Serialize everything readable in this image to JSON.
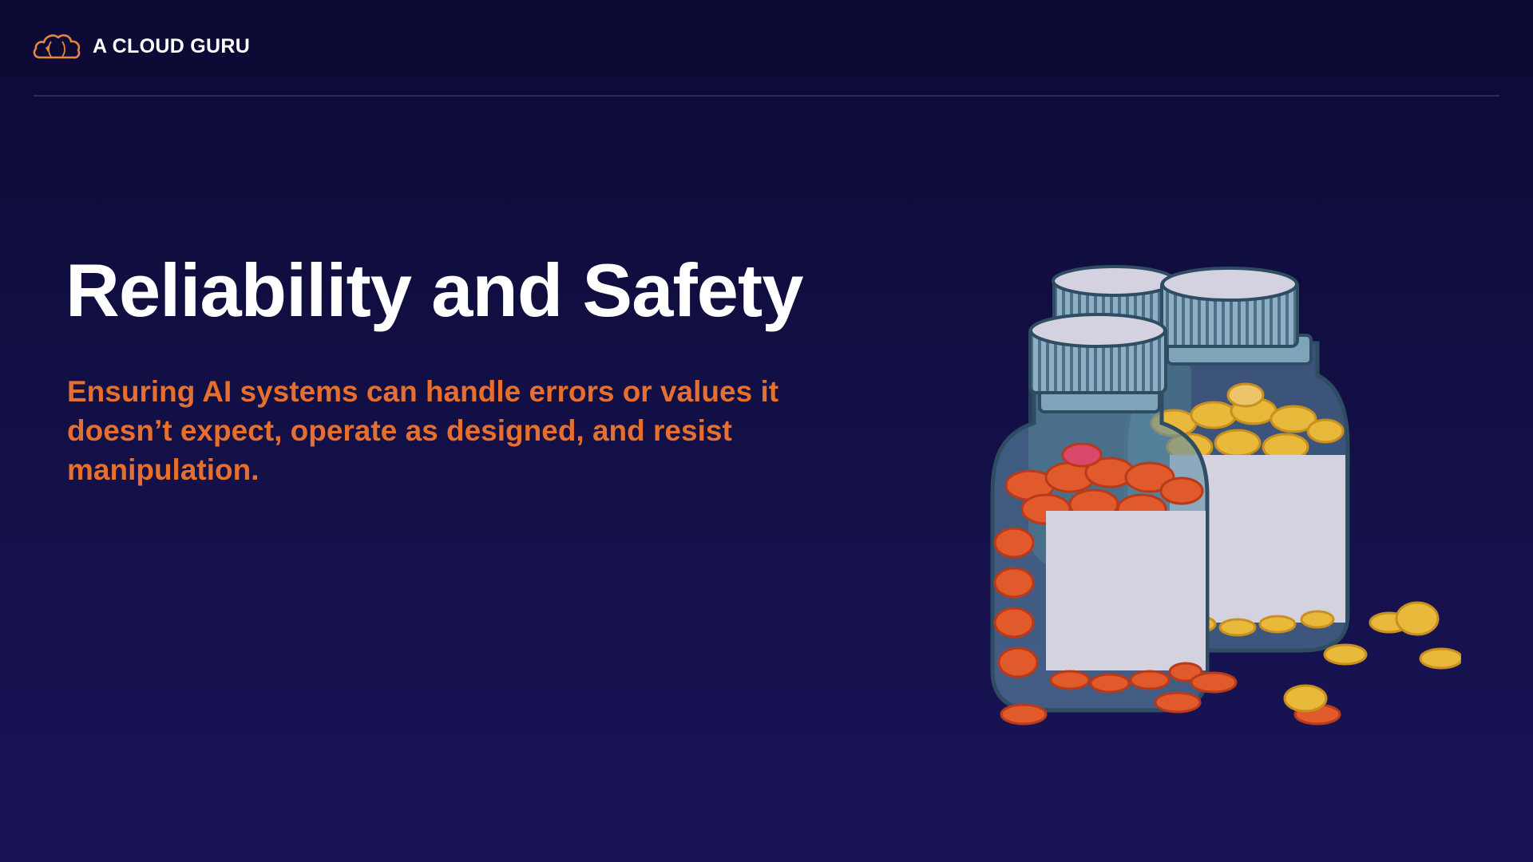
{
  "brand": {
    "name": "A CLOUD GURU",
    "logo_icon": "cloud-guru-logo-icon"
  },
  "slide": {
    "title": "Reliability and Safety",
    "subtitle": "Ensuring AI systems can handle errors or values it doesn’t expect, operate as designed, and resist manipulation."
  },
  "illustration": {
    "icon": "pill-bottles-illustration",
    "colors": {
      "background": "#120f45",
      "accent_orange": "#e66f2d",
      "red_pills": "#e05a2b",
      "yellow_pills": "#e8b93a",
      "glass": "#5d8fa6",
      "cap": "#6f97b0",
      "label": "#d4d2df"
    }
  }
}
